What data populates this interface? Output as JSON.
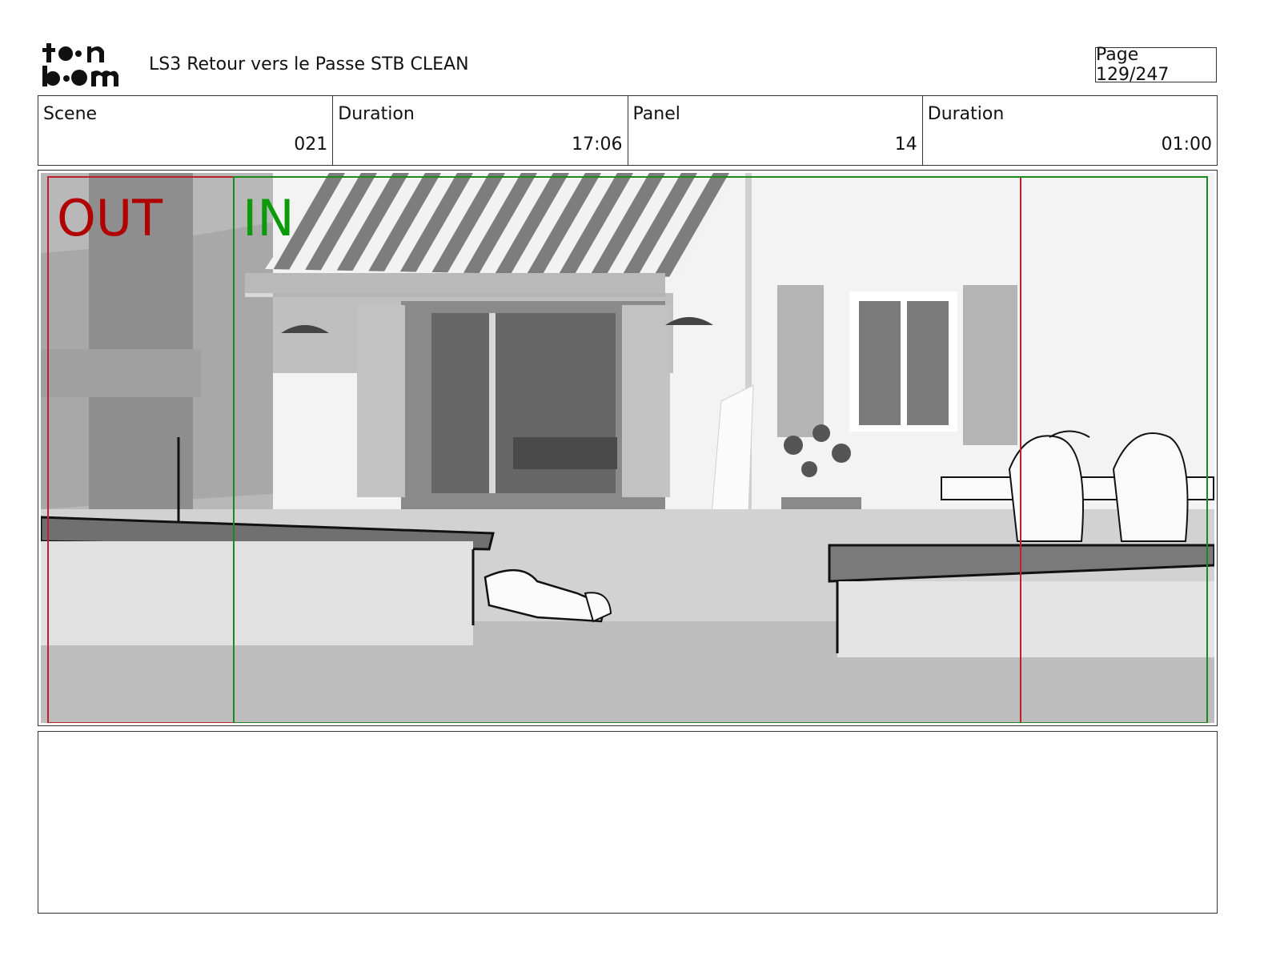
{
  "header": {
    "logo_text": "toon boom",
    "title": "LS3 Retour vers le Passe STB CLEAN",
    "page_label": "Page 129/247"
  },
  "info": [
    {
      "label": "Scene",
      "value": "021"
    },
    {
      "label": "Duration",
      "value": "17:06"
    },
    {
      "label": "Panel",
      "value": "14"
    },
    {
      "label": "Duration",
      "value": "01:00"
    }
  ],
  "panel": {
    "out_label": "OUT",
    "in_label": "IN",
    "colors": {
      "out": "#b00000",
      "in": "#0a9a0a"
    }
  },
  "notes": {
    "text": ""
  }
}
